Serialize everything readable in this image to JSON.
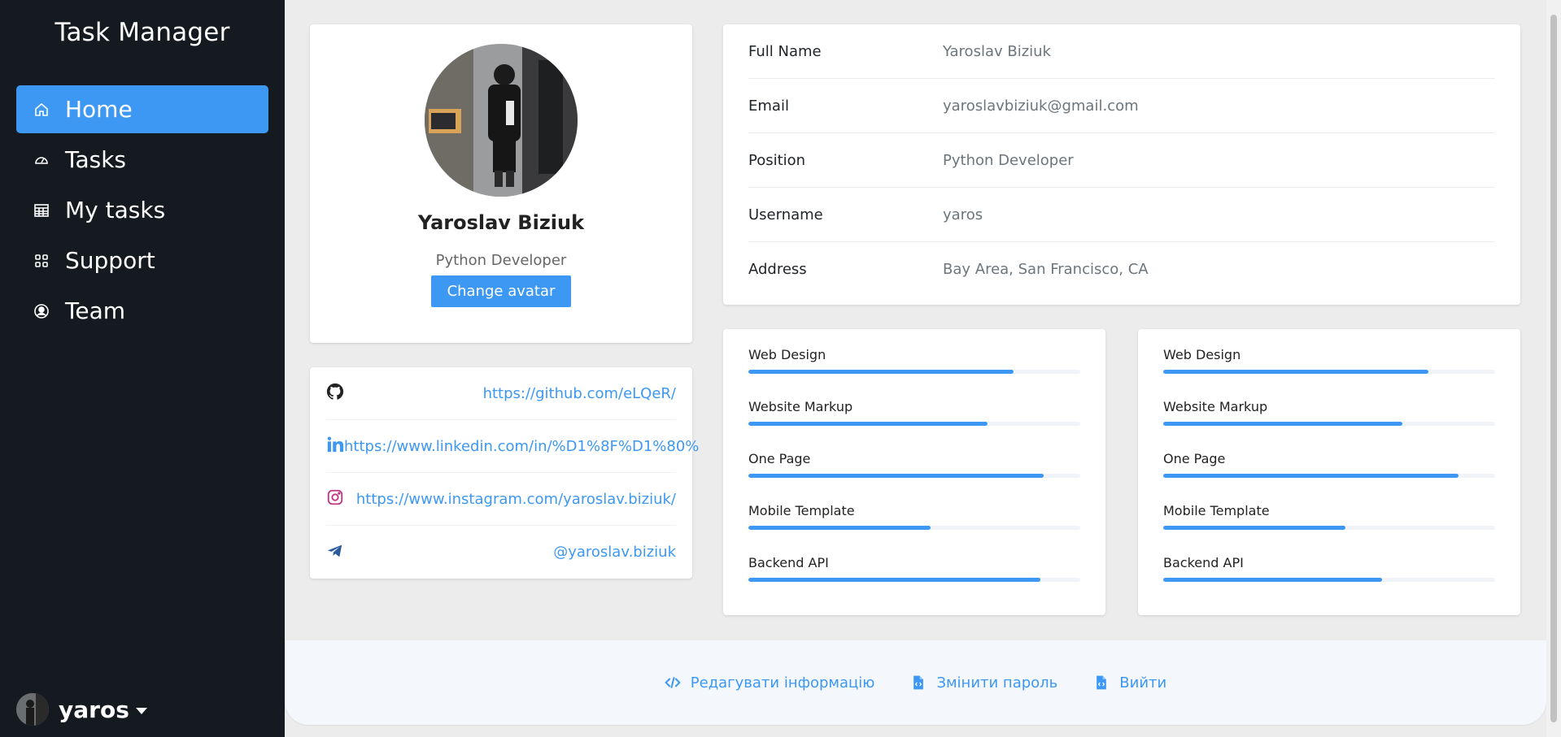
{
  "sidebar": {
    "brand": "Task Manager",
    "items": [
      {
        "label": "Home",
        "icon": "home-icon",
        "active": true
      },
      {
        "label": "Tasks",
        "icon": "speedometer-icon"
      },
      {
        "label": "My tasks",
        "icon": "table-icon"
      },
      {
        "label": "Support",
        "icon": "grid-icon"
      },
      {
        "label": "Team",
        "icon": "user-circle-icon"
      }
    ],
    "user": {
      "name": "yaros"
    }
  },
  "profile": {
    "name": "Yaroslav Biziuk",
    "position": "Python Developer",
    "change_avatar_label": "Change avatar"
  },
  "social": {
    "github": "https://github.com/eLQeR/",
    "linkedin": "https://www.linkedin.com/in/%D1%8F%D1%80%",
    "instagram": "https://www.instagram.com/yaroslav.biziuk/",
    "telegram": "@yaroslav.biziuk"
  },
  "info": {
    "rows": [
      {
        "label": "Full Name",
        "value": "Yaroslav Biziuk"
      },
      {
        "label": "Email",
        "value": "yaroslavbiziuk@gmail.com"
      },
      {
        "label": "Position",
        "value": "Python Developer"
      },
      {
        "label": "Username",
        "value": "yaros"
      },
      {
        "label": "Address",
        "value": "Bay Area, San Francisco, CA"
      }
    ]
  },
  "skills_left": [
    {
      "name": "Web Design",
      "percent": 80
    },
    {
      "name": "Website Markup",
      "percent": 72
    },
    {
      "name": "One Page",
      "percent": 89
    },
    {
      "name": "Mobile Template",
      "percent": 55
    },
    {
      "name": "Backend API",
      "percent": 88
    }
  ],
  "skills_right": [
    {
      "name": "Web Design",
      "percent": 80
    },
    {
      "name": "Website Markup",
      "percent": 72
    },
    {
      "name": "One Page",
      "percent": 89
    },
    {
      "name": "Mobile Template",
      "percent": 55
    },
    {
      "name": "Backend API",
      "percent": 66
    }
  ],
  "footer": {
    "edit_label": "Редагувати інформацію",
    "password_label": "Змінити пароль",
    "logout_label": "Вийти"
  },
  "colors": {
    "accent": "#3d98f4",
    "sidebar_bg": "#141a20",
    "page_bg": "#ececec",
    "instagram": "#c13584",
    "telegram": "#2c5b9c"
  }
}
